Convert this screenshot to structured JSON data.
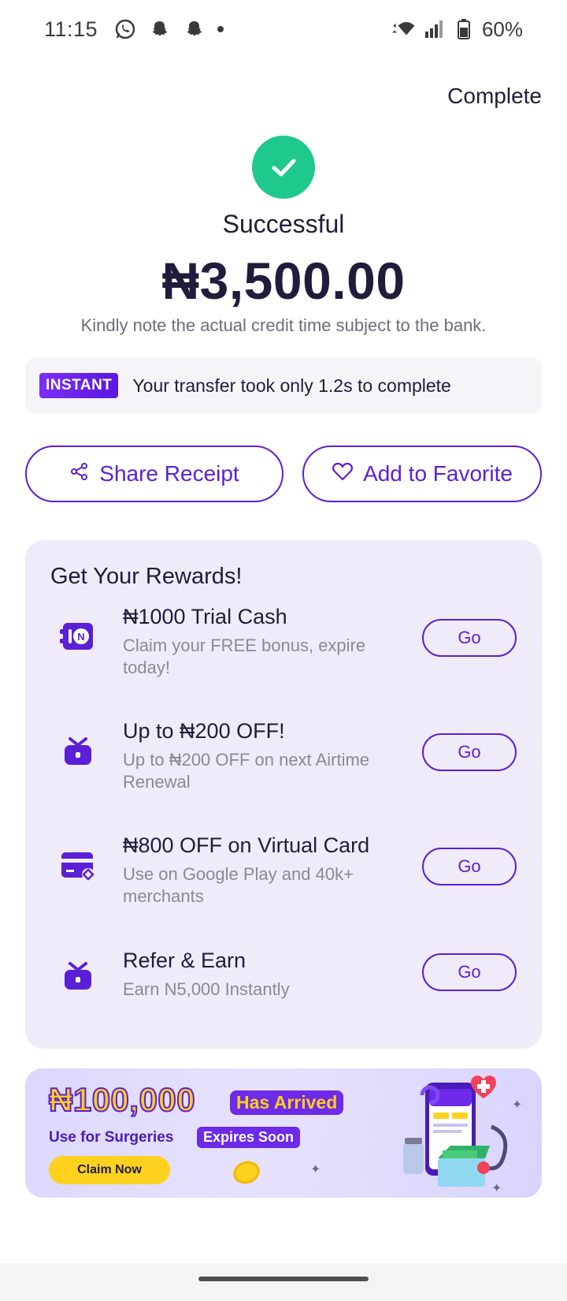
{
  "status_bar": {
    "time": "11:15",
    "battery": "60%"
  },
  "header": {
    "complete_label": "Complete"
  },
  "result": {
    "status": "Successful",
    "amount": "₦3,500.00",
    "note": "Kindly note the actual credit time subject to the bank."
  },
  "instant": {
    "badge": "INSTANT",
    "text": "Your transfer took only 1.2s to complete"
  },
  "actions": {
    "share_label": "Share Receipt",
    "favorite_label": "Add to Favorite"
  },
  "rewards": {
    "title": "Get Your Rewards!",
    "items": [
      {
        "title": "₦1000 Trial Cash",
        "desc": "Claim your FREE bonus, expire today!",
        "icon": "safe-icon",
        "button": "Go"
      },
      {
        "title": "Up to ₦200 OFF!",
        "desc": "Up to ₦200 OFF on next Airtime Renewal",
        "icon": "gift-icon",
        "button": "Go"
      },
      {
        "title": "₦800 OFF on Virtual Card",
        "desc": "Use on Google Play and 40k+ merchants",
        "icon": "card-icon",
        "button": "Go"
      },
      {
        "title": "Refer & Earn",
        "desc": "Earn N5,000 Instantly",
        "icon": "gift-icon",
        "button": "Go"
      }
    ]
  },
  "banner": {
    "amount": "₦100,000",
    "arrived": "Has Arrived",
    "use_text": "Use for Surgeries",
    "expires": "Expires Soon",
    "claim_label": "Claim Now"
  },
  "colors": {
    "accent": "#5b1fd6",
    "success": "#1ec98b",
    "rewards_bg": "#efebf9",
    "banner_yellow": "#ffd21f"
  }
}
